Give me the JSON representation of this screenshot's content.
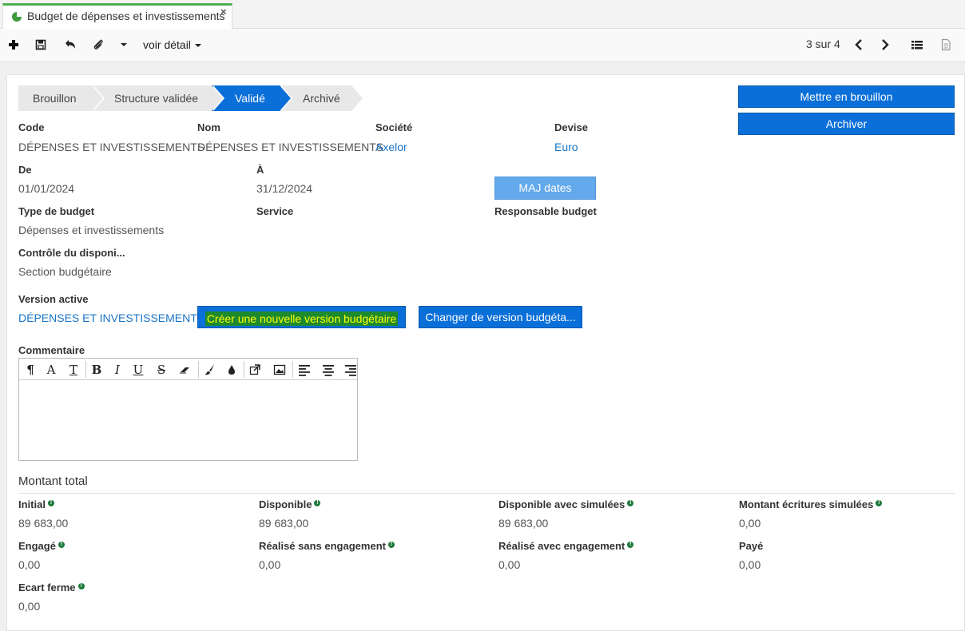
{
  "tab": {
    "title": "Budget de dépenses et investissements",
    "close": "×",
    "icon": "pie-chart-icon"
  },
  "toolbar": {
    "view_detail": "voir détail",
    "pager": "3 sur 4",
    "icons": [
      "plus-icon",
      "save-icon",
      "undo-icon",
      "paperclip-icon",
      "caret-down-icon",
      "chevron-left-icon",
      "chevron-right-icon",
      "list-view-icon",
      "document-icon"
    ]
  },
  "status_steps": [
    {
      "label": "Brouillon",
      "active": false
    },
    {
      "label": "Structure validée",
      "active": false
    },
    {
      "label": "Validé",
      "active": true
    },
    {
      "label": "Archivé",
      "active": false
    }
  ],
  "actions": {
    "draft": "Mettre en brouillon",
    "archive": "Archiver",
    "update_dates": "MAJ dates",
    "new_version": "Créer une nouvelle version budgétaire",
    "change_version": "Changer de version budgéta..."
  },
  "fields": {
    "code": {
      "label": "Code",
      "value": "DÉPENSES ET INVESTISSEMENTS"
    },
    "name": {
      "label": "Nom",
      "value": "DÉPENSES ET INVESTISSEMENTS"
    },
    "company": {
      "label": "Société",
      "value": "Axelor"
    },
    "currency": {
      "label": "Devise",
      "value": "Euro"
    },
    "from": {
      "label": "De",
      "value": "01/01/2024"
    },
    "to": {
      "label": "À",
      "value": "31/12/2024"
    },
    "budget_type": {
      "label": "Type de budget",
      "value": "Dépenses et investissements"
    },
    "service": {
      "label": "Service",
      "value": ""
    },
    "budget_manager": {
      "label": "Responsable budget",
      "value": ""
    },
    "availability_control": {
      "label": "Contrôle du disponi...",
      "value": "Section budgétaire"
    },
    "active_version": {
      "label": "Version active",
      "value": "DÉPENSES ET INVESTISSEMENTS"
    },
    "comment": {
      "label": "Commentaire",
      "value": ""
    }
  },
  "editor_tools": [
    "¶",
    "A",
    "T",
    "B",
    "I",
    "U",
    "S"
  ],
  "totals": {
    "title": "Montant total",
    "items": [
      {
        "label": "Initial",
        "value": "89 683,00",
        "info": true
      },
      {
        "label": "Disponible",
        "value": "89 683,00",
        "info": true
      },
      {
        "label": "Disponible avec simulées",
        "value": "89 683,00",
        "info": true
      },
      {
        "label": "Montant écritures simulées",
        "value": "0,00",
        "info": true
      },
      {
        "label": "Engagé",
        "value": "0,00",
        "info": true
      },
      {
        "label": "Réalisé sans engagement",
        "value": "0,00",
        "info": true
      },
      {
        "label": "Réalisé avec engagement",
        "value": "0,00",
        "info": true
      },
      {
        "label": "Payé",
        "value": "0,00",
        "info": false
      },
      {
        "label": "Ecart ferme",
        "value": "0,00",
        "info": true
      }
    ]
  },
  "colors": {
    "primary": "#0a6fd8",
    "primary_light": "#63a9ec",
    "link": "#1b75c8",
    "tab_accent": "#4caf50",
    "highlight_bg": "#1e8a2e",
    "highlight_text": "#ffff00"
  }
}
